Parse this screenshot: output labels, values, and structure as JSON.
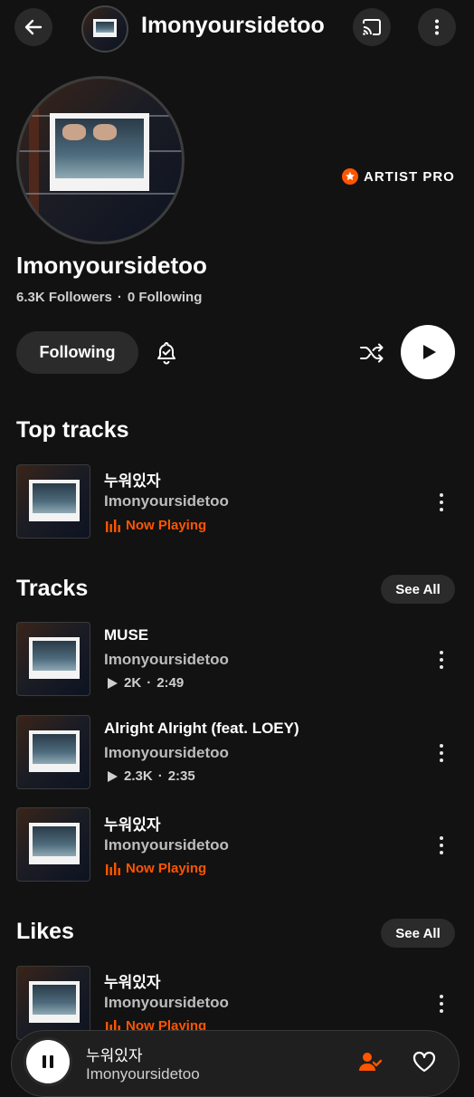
{
  "header": {
    "title": "Imonyoursidetoo"
  },
  "profile": {
    "name": "Imonyoursidetoo",
    "followers": "6.3K Followers",
    "separator": "·",
    "following_count": "0 Following",
    "badge": "ARTIST PRO",
    "follow_button": "Following"
  },
  "colors": {
    "accent": "#ff5500",
    "background": "#121212",
    "pill": "#2b2b2b"
  },
  "icons": [
    "back-arrow-icon",
    "cast-icon",
    "more-vert-icon",
    "bell-check-icon",
    "shuffle-icon",
    "play-icon",
    "star-badge-icon",
    "equalizer-icon",
    "pause-icon",
    "person-check-icon",
    "heart-icon"
  ],
  "top_tracks": {
    "title": "Top tracks",
    "items": [
      {
        "title": "누워있자",
        "artist": "Imonyoursidetoo",
        "status": "Now Playing"
      }
    ]
  },
  "tracks": {
    "title": "Tracks",
    "see_all": "See All",
    "items": [
      {
        "title": "MUSE",
        "artist": "Imonyoursidetoo",
        "plays": "2K",
        "sep": "·",
        "duration": "2:49"
      },
      {
        "title": "Alright Alright (feat. LOEY)",
        "artist": "Imonyoursidetoo",
        "plays": "2.3K",
        "sep": "·",
        "duration": "2:35"
      },
      {
        "title": "누워있자",
        "artist": "Imonyoursidetoo",
        "status": "Now Playing"
      }
    ]
  },
  "likes": {
    "title": "Likes",
    "see_all": "See All",
    "items": [
      {
        "title": "누워있자",
        "artist": "Imonyoursidetoo",
        "status": "Now Playing"
      }
    ]
  },
  "mini_player": {
    "title": "누워있자",
    "artist": "Imonyoursidetoo"
  }
}
